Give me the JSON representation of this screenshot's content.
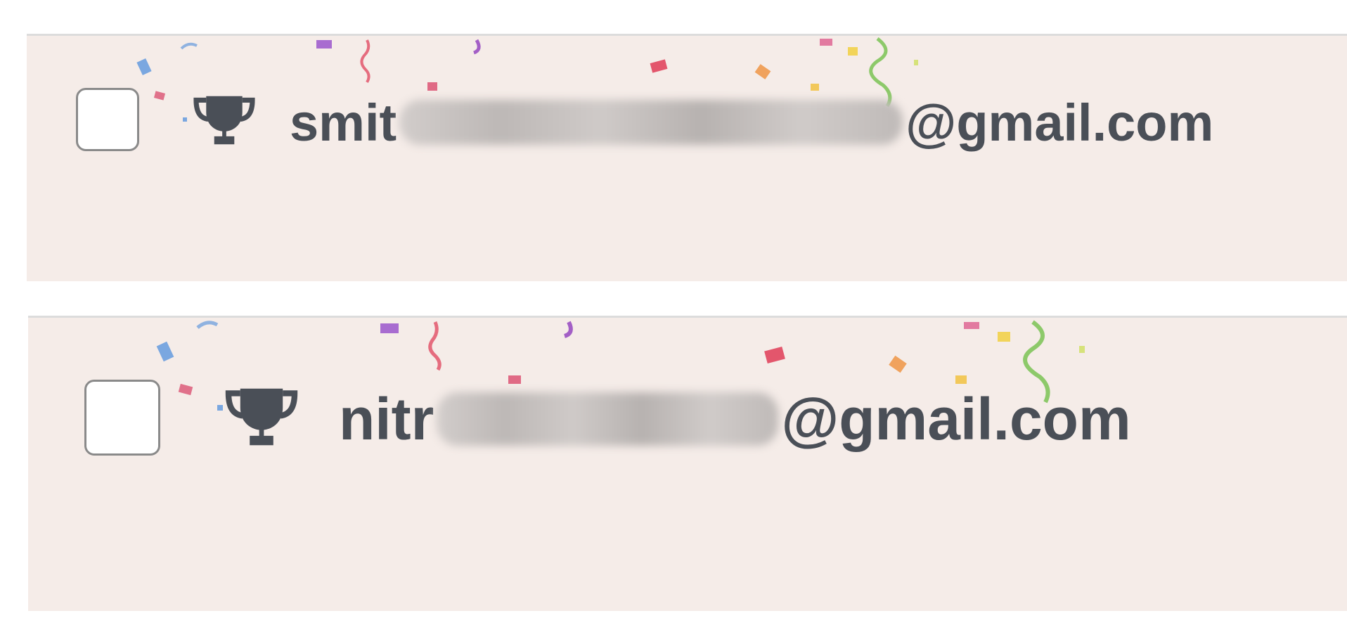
{
  "list": {
    "rows": [
      {
        "checked": false,
        "icon": "trophy-icon",
        "email_prefix": "smit",
        "email_suffix": "@gmail.com"
      },
      {
        "checked": false,
        "icon": "trophy-icon",
        "email_prefix": "nitr",
        "email_suffix": "@gmail.com"
      }
    ]
  },
  "colors": {
    "row_background": "#f5ece8",
    "text": "#4a4f57",
    "checkbox_border": "#8a8a8a",
    "row_border": "#dcdcdc"
  }
}
